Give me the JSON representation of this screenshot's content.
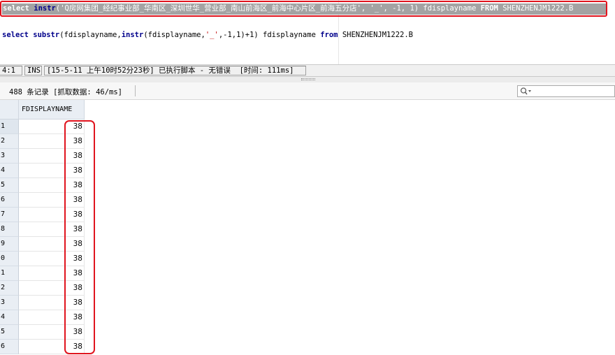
{
  "editor": {
    "line1": {
      "kw_select": "select",
      "fn_instr": "instr",
      "text_a": "('Q房网集团_经纪事业部_华南区_深圳世华_营业部_南山前海区_前海中心片区_前海五分店', '_', -1, 1) fdisplayname ",
      "kw_from": "FROM",
      "text_b": " SHENZHENJM1222.B"
    },
    "line2": {
      "kw_select": "select",
      "fn_substr": "substr",
      "text_a": "(fdisplayname,",
      "fn_instr": "instr",
      "text_b": "(fdisplayname,",
      "str_underscore": "'_'",
      "text_c": ",-1,1)+1) fdisplayname ",
      "kw_from": "from",
      "text_d": " SHENZHENJM1222.B"
    }
  },
  "statusbar": {
    "position": "4:1",
    "mode": "INS",
    "message": "[15-5-11 上午10时52分23秒] 已执行脚本 - 无错误  [时间: 111ms]"
  },
  "results": {
    "record_count": "488 条记录 [抓取数据: 46/ms]",
    "search_icon": "search-icon",
    "column_header": "FDISPLAYNAME",
    "rows": [
      {
        "num": "1",
        "value": "38"
      },
      {
        "num": "2",
        "value": "38"
      },
      {
        "num": "3",
        "value": "38"
      },
      {
        "num": "4",
        "value": "38"
      },
      {
        "num": "5",
        "value": "38"
      },
      {
        "num": "6",
        "value": "38"
      },
      {
        "num": "7",
        "value": "38"
      },
      {
        "num": "8",
        "value": "38"
      },
      {
        "num": "9",
        "value": "38"
      },
      {
        "num": "0",
        "value": "38"
      },
      {
        "num": "1",
        "value": "38"
      },
      {
        "num": "2",
        "value": "38"
      },
      {
        "num": "3",
        "value": "38"
      },
      {
        "num": "4",
        "value": "38"
      },
      {
        "num": "5",
        "value": "38"
      },
      {
        "num": "6",
        "value": "38"
      }
    ]
  },
  "colors": {
    "highlight_red": "#e0141e",
    "keyword_blue": "#00008b",
    "selection_gray": "#a3a3a3"
  }
}
